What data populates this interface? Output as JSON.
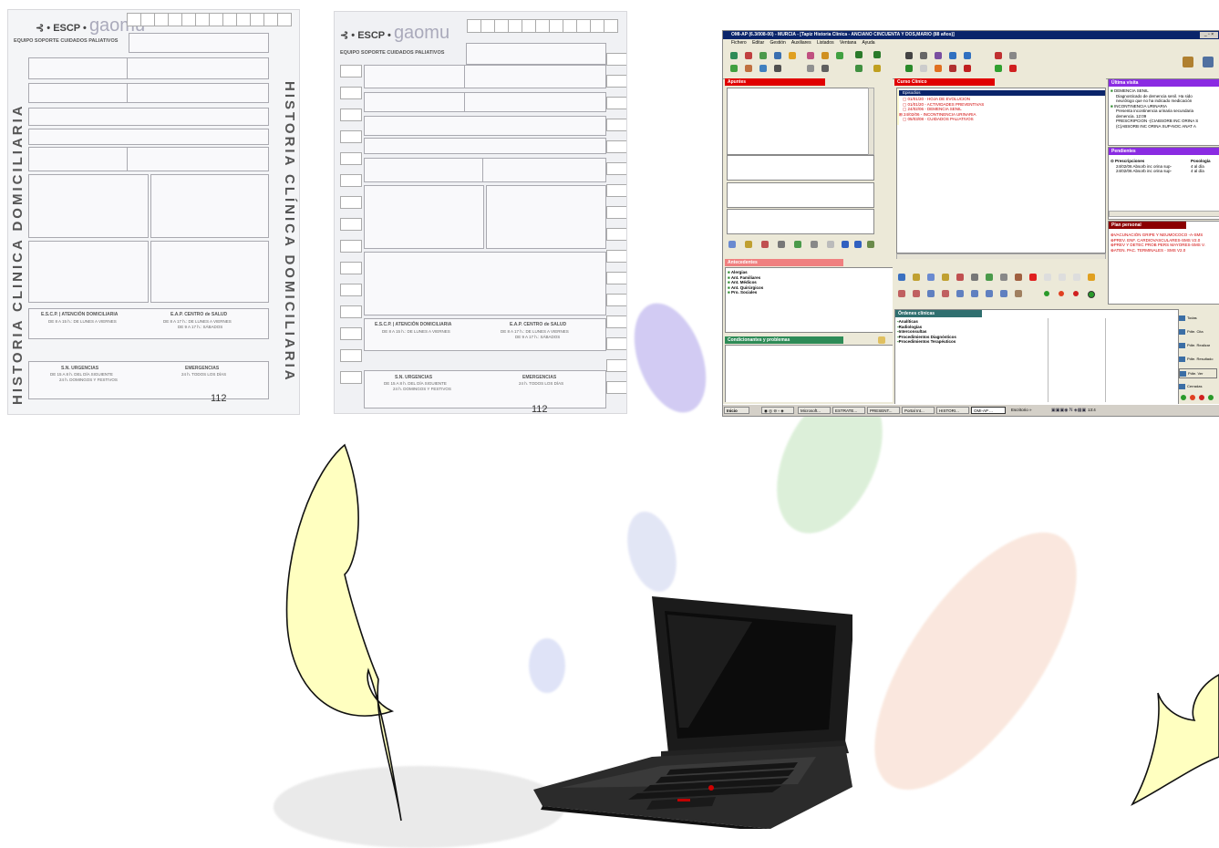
{
  "form_left": {
    "brand": "ESCP",
    "logo_text": "gaomu",
    "subtitle": "EQUIPO SOPORTE CUIDADOS PALIATIVOS",
    "vertical_left": "HISTORIA CLINICA DOMICILIARIA",
    "vertical_right": "HISTORIA CLÍNICA DOMICILIARIA",
    "footer_left_title": "E.S.C.P.",
    "footer_left_service": "ATENCIÓN DOMICILIARIA",
    "footer_left_hours": "DE 8 A 15 h.: DE LUNES A VIERNES",
    "footer_right_title": "E.A.P. CENTRO de SALUD",
    "footer_right_hours1": "DE 8 A 17 h.: DE LUNES A VIERNES",
    "footer_right_hours2": "DE 9 A 17 h.: SÁBADOS",
    "urg_title": "S.N. URGENCIAS",
    "urg_hours1": "DE 15 A 8 h. DEL DÍA SIGUIENTE",
    "urg_hours2": "24 h. DOMINGOS Y FESTIVOS",
    "emerg_title": "EMERGENCIAS",
    "emerg_hours": "24 h. TODOS LOS DÍAS",
    "page_number": "112"
  },
  "form_right": {
    "brand": "ESCP",
    "logo_text": "gaomu",
    "subtitle": "EQUIPO SOPORTE CUIDADOS PALIATIVOS",
    "footer_left_title": "E.S.C.P.",
    "footer_left_service": "ATENCIÓN DOMICILIARIA",
    "footer_left_hours": "DE 8 A 15 h.: DE LUNES A VIERNES",
    "footer_right_title": "E.A.P. CENTRO de SALUD",
    "footer_right_hours1": "DE 8 A 17 h.: DE LUNES A VIERNES",
    "footer_right_hours2": "DE 9 A 17 h.: SÁBADOS",
    "urg_title": "S.N. URGENCIAS",
    "urg_hours1": "DE 15 A 8 h. DEL DÍA SIGUIENTE",
    "urg_hours2": "24 h. DOMINGOS Y FESTIVOS",
    "emerg_title": "EMERGENCIAS",
    "emerg_hours": "24 h. TODOS LOS DÍAS",
    "page_number": "112"
  },
  "omi": {
    "title": "OMI-AP (6.3/008-00) - MURCIA - [Tapiz Historia Clínica - ANCIANO CINCUENTA Y DOS,MARIO (88 años)]",
    "menu": [
      "Fichero",
      "Editar",
      "Gestión",
      "Auxiliares",
      "Listados",
      "Ventana",
      "Ayuda"
    ],
    "apuntes": {
      "header": "Apuntes"
    },
    "curso": {
      "header": "Curso Clínico",
      "selected": "Episodios",
      "items": [
        "01/01/20 - HOJA DE EVOLUCION",
        "01/01/20 - ACTIVIDADES PREVENTIVAS",
        "24/02/06 - DEMENCIA SENIL",
        "24/02/06 - INCONTINENCIA URINARIA",
        "05/03/08 - CUIDADOS PALIATIVOS"
      ]
    },
    "ultima": {
      "header": "Última visita",
      "lines": [
        "DEMENCIA SENIL",
        "Diagnosticado de demencia senil. Ha sido",
        "neurólogo que no ha indicado medicación",
        "INCONTINENCIA URINARIA",
        "Presenta incontinencia urinaria secundaria",
        "demencia. 12:09",
        "PRESCRIPCION -(CIABSORB INC ORINA S",
        "(C)ABSORB INC ORINA SUP-NOC ANAT A"
      ]
    },
    "pendientes": {
      "header": "Pendientes",
      "col1": "Prescripciones",
      "col2": "Posología",
      "rows": [
        [
          "24/02/06 Absorb inc orina sup-",
          "4 al día"
        ],
        [
          "24/02/06 Absorb inc orina sup-",
          "4 al día"
        ]
      ]
    },
    "plan": {
      "header": "Plan personal",
      "items": [
        "VACUNACIÓN GRIPE Y NEUMOCOCO -A-SMS",
        "PREV. ENF. CARDIOVASCULARES-SMS V2.0",
        "PREV Y DETEC PROB PERS MAYORES-SMS V.",
        "ATEN. PAC. TERMINALES - SMS V2.0"
      ]
    },
    "antecedentes": {
      "header": "Antecedentes",
      "items": [
        "Alergias",
        "Ant. Familiares",
        "Ant. Médicos",
        "Ant. Quirúrgicos",
        "Pro. Sociales"
      ]
    },
    "condicionantes": {
      "header": "Condicionantes y problemas"
    },
    "ordenes": {
      "header": "Órdenes clínicas",
      "items": [
        "Analíticas",
        "Radiologías",
        "Interconsultas",
        "Procedimientos Diagnósticos",
        "Procedimientos Terapéuticos"
      ]
    },
    "side_buttons": [
      "Todas",
      "Pdte. Cita",
      "Pdte. Realizar",
      "Pdte. Resultado",
      "Pdte. Ver",
      "Cerradas"
    ],
    "taskbar": {
      "start": "Inicio",
      "tasks": [
        "Microsoft...",
        "ESTRATE...",
        "PRESENT...",
        "Portal Int...",
        "HISTORI...",
        "OMI-AP ..."
      ],
      "escritorio": "Escritorio",
      "clock": "13:4"
    }
  },
  "colors": {
    "apuntes_header": "#e00000",
    "curso_header": "#e00000",
    "ultima_header": "#8a2be2",
    "pendientes_header": "#8a2be2",
    "plan_header": "#8b0000",
    "antecedentes_header": "#f08080",
    "condicionantes_header": "#2e8b57",
    "ordenes_header": "#2f6f6f",
    "callout_fill": "#ffffc0"
  },
  "icons": [
    "laptop-icon",
    "callout-left-shape",
    "callout-right-shape",
    "folder-icon"
  ]
}
